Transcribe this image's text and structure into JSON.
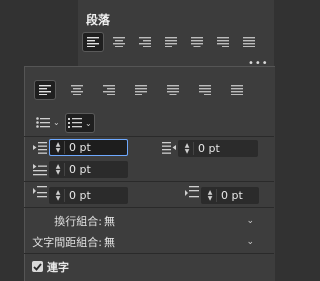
{
  "back_panel": {
    "title": "段落"
  },
  "menu": {
    "icon": "more-dots-icon",
    "glyph": "•••"
  },
  "alignment": {
    "buttons": [
      "align-left",
      "align-center",
      "align-right",
      "justify-last-left",
      "justify-last-center",
      "justify-last-right",
      "justify-all"
    ],
    "active": "align-left"
  },
  "lists": {
    "bullet_icon": "bulleted-list-icon",
    "number_icon": "numbered-list-icon",
    "caret": "⌄"
  },
  "indents": {
    "left_indent": {
      "value": "0 pt",
      "icon": "left-indent-icon"
    },
    "right_indent": {
      "value": "0 pt",
      "icon": "right-indent-icon"
    },
    "first_line_indent": {
      "value": "0 pt",
      "icon": "first-line-indent-icon"
    },
    "space_before": {
      "value": "0 pt",
      "icon": "space-before-icon"
    },
    "space_after": {
      "value": "0 pt",
      "icon": "space-after-icon"
    }
  },
  "composer": {
    "label": "換行組合:",
    "value": "無"
  },
  "mojikumi": {
    "label": "文字間距組合:",
    "value": "無"
  },
  "hyphenation": {
    "label": "連字",
    "checked": true
  },
  "colors": {
    "panel": "#3d3d3d",
    "focus": "#6ea9ff",
    "field": "#2b2b2b"
  }
}
